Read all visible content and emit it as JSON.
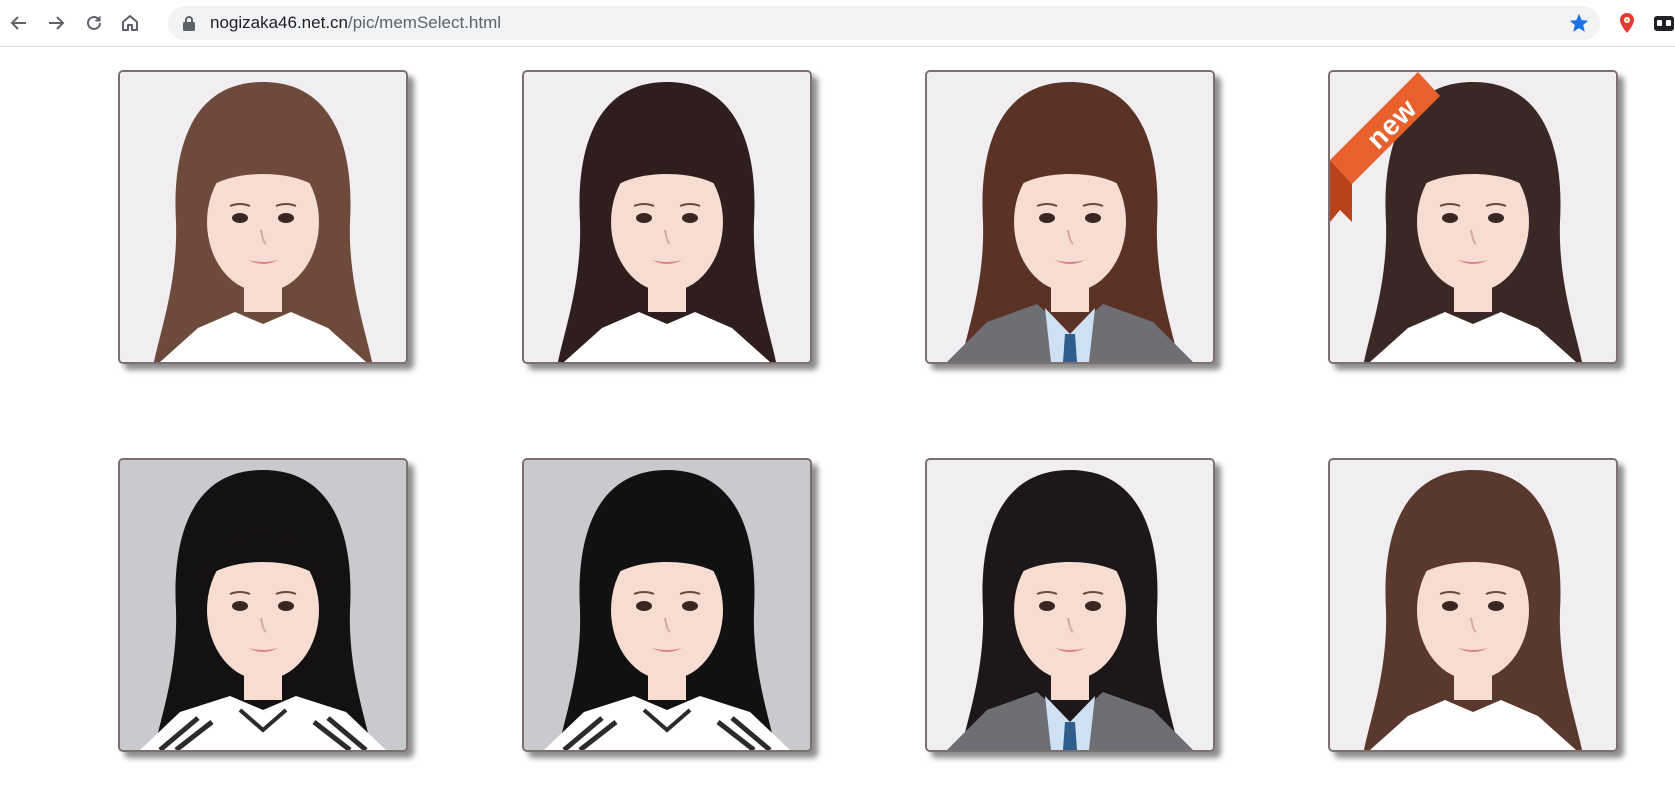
{
  "browser": {
    "url_host": "nogizaka46.net.cn",
    "url_path": "/pic/memSelect.html",
    "icons": [
      "back-icon",
      "forward-icon",
      "reload-icon",
      "home-icon",
      "lock-icon",
      "star-icon",
      "location-pin-icon",
      "extension-icon"
    ],
    "accent_color": "#1a73e8"
  },
  "members": [
    {
      "hair": "#6e4a3c",
      "bg": "light",
      "outfit": "white-blouse",
      "badge": ""
    },
    {
      "hair": "#2e1f1e",
      "bg": "light",
      "outfit": "white-blouse",
      "badge": ""
    },
    {
      "hair": "#5a3226",
      "bg": "light",
      "outfit": "grey-blazer",
      "badge": ""
    },
    {
      "hair": "#3a2824",
      "bg": "light",
      "outfit": "white-blouse",
      "badge": "new"
    },
    {
      "hair": "#141112",
      "bg": "grey",
      "outfit": "sailor-uniform",
      "badge": ""
    },
    {
      "hair": "#111111",
      "bg": "grey",
      "outfit": "sailor-uniform",
      "badge": ""
    },
    {
      "hair": "#1e1719",
      "bg": "light",
      "outfit": "grey-blazer",
      "badge": ""
    },
    {
      "hair": "#5a382d",
      "bg": "light",
      "outfit": "white-blouse",
      "badge": ""
    }
  ],
  "ribbon_color": "#e8612c"
}
